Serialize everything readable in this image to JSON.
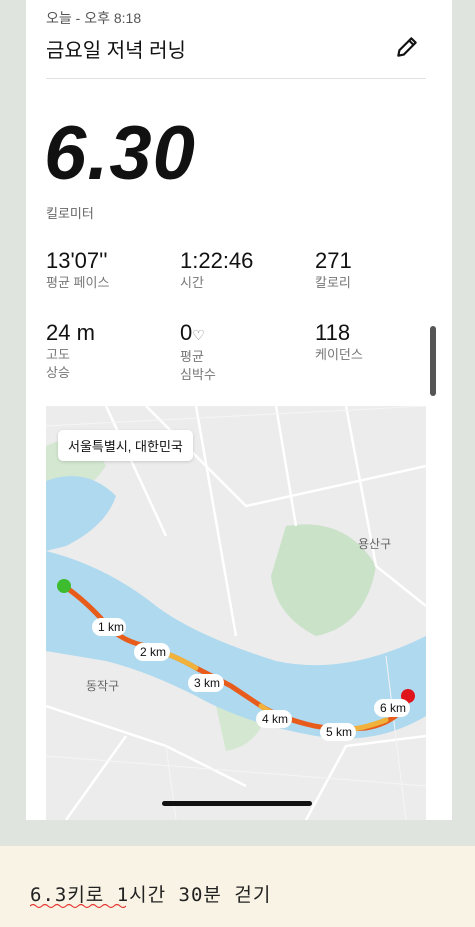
{
  "header": {
    "time": "오늘 - 오후 8:18",
    "title": "금요일 저녁 러닝",
    "edit_icon": "pencil-icon"
  },
  "distance": {
    "value": "6.30",
    "unit": "킬로미터"
  },
  "stats": {
    "pace": {
      "value": "13'07''",
      "label": "평균 페이스"
    },
    "time": {
      "value": "1:22:46",
      "label": "시간"
    },
    "calories": {
      "value": "271",
      "label": "칼로리"
    },
    "elevation": {
      "value": "24 m",
      "label": "고도\n상승"
    },
    "heart_rate": {
      "value": "0",
      "label": "평균\n심박수",
      "icon": "heart-icon"
    },
    "cadence": {
      "value": "118",
      "label": "케이던스"
    }
  },
  "map": {
    "location": "서울특별시, 대한민국",
    "district_labels": {
      "yongsan": "용산구",
      "dongjak": "동작구"
    },
    "km_markers": [
      "1 km",
      "2 km",
      "3 km",
      "4 km",
      "5 km",
      "6 km"
    ],
    "colors": {
      "water": "#aed9ef",
      "land": "#ececec",
      "park": "#c9e2c8",
      "start": "#3cbc2e",
      "end": "#e0141b"
    }
  },
  "note": {
    "text": "6.3키로 1시간 30분 걷기"
  }
}
